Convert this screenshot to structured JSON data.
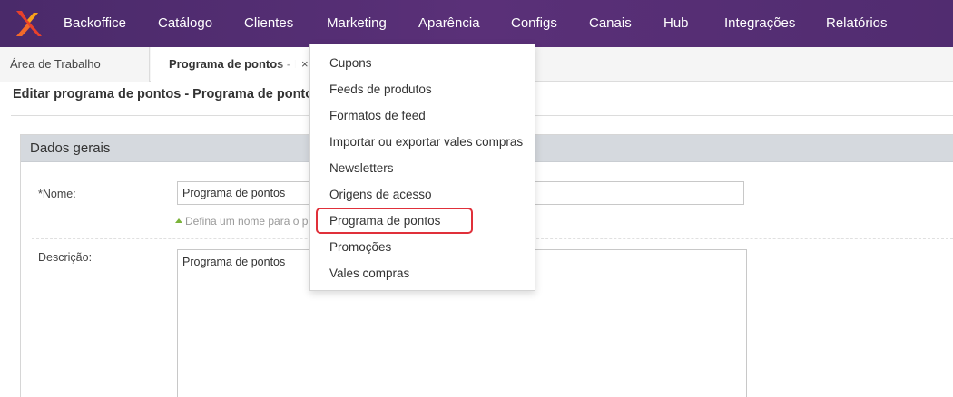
{
  "topnav": {
    "logo_icon": "app-logo-icon",
    "items": [
      {
        "label": "Backoffice"
      },
      {
        "label": "Catálogo"
      },
      {
        "label": "Clientes"
      },
      {
        "label": "Marketing"
      },
      {
        "label": "Aparência"
      },
      {
        "label": "Configs"
      },
      {
        "label": "Canais"
      },
      {
        "label": "Hub"
      },
      {
        "label": "Integrações"
      },
      {
        "label": "Relatórios"
      }
    ]
  },
  "tabs": {
    "home": "Área de Trabalho",
    "active": "Programa de pontos - Programa de pontos",
    "close_glyph": "×"
  },
  "page": {
    "title": "Editar programa de pontos - Programa de pontos"
  },
  "section": {
    "header": "Dados gerais",
    "name_label": "*Nome:",
    "name_value": "Programa de pontos",
    "name_hint": "Defina um nome para o pr",
    "description_label": "Descrição:",
    "description_value": "Programa de pontos"
  },
  "marketing_menu": {
    "items": [
      {
        "label": "Cupons"
      },
      {
        "label": "Feeds de produtos"
      },
      {
        "label": "Formatos de feed"
      },
      {
        "label": "Importar ou exportar vales compras"
      },
      {
        "label": "Newsletters"
      },
      {
        "label": "Origens de acesso"
      },
      {
        "label": "Programa de pontos"
      },
      {
        "label": "Promoções"
      },
      {
        "label": "Vales compras"
      }
    ],
    "highlighted_item": "Programa de pontos",
    "highlight_color": "#e0303a"
  },
  "colors": {
    "topnav_bg": "#4f2c6f",
    "logo_red": "#e8412c",
    "logo_orange": "#f7a21b",
    "hint_arrow": "#7bb33a"
  }
}
